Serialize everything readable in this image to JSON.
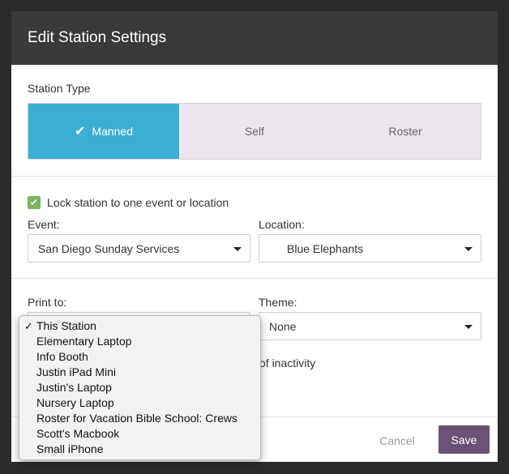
{
  "modal": {
    "title": "Edit Station Settings"
  },
  "station_type": {
    "label": "Station Type",
    "options": [
      "Manned",
      "Self",
      "Roster"
    ],
    "selected": "Manned",
    "accent_color": "#3aaed4"
  },
  "lock": {
    "checked": true,
    "label": "Lock station to one event or location",
    "event_label": "Event:",
    "event_value": "San Diego Sunday Services",
    "location_label": "Location:",
    "location_value": "Blue Elephants"
  },
  "print": {
    "print_label": "Print to:",
    "theme_label": "Theme:",
    "theme_value": "None",
    "partial_text": "of inactivity"
  },
  "footer": {
    "cancel_label": "Cancel",
    "save_label": "Save",
    "save_color": "#6a5276"
  },
  "print_dropdown": {
    "selected": "This Station",
    "options": [
      "This Station",
      "Elementary Laptop",
      "Info Booth",
      "Justin iPad Mini",
      "Justin's Laptop",
      "Nursery Laptop",
      "Roster for Vacation Bible School: Crews",
      "Scott's Macbook",
      "Small iPhone"
    ]
  }
}
